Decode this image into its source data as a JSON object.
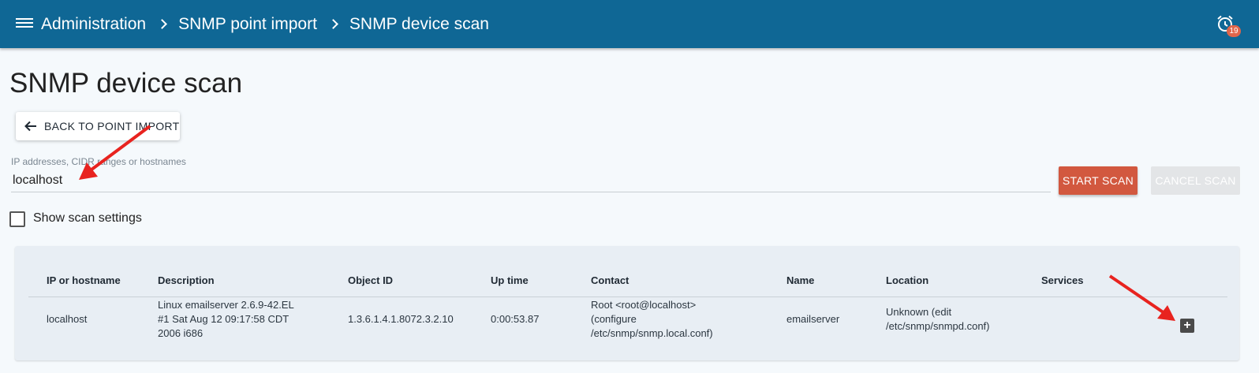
{
  "header": {
    "breadcrumbs": [
      {
        "label": "Administration"
      },
      {
        "label": "SNMP point import"
      },
      {
        "label": "SNMP device scan"
      }
    ],
    "alarm_count": "19"
  },
  "page": {
    "title": "SNMP device scan",
    "back_label": "BACK TO POINT IMPORT"
  },
  "scan": {
    "input_label": "IP addresses, CIDR ranges or hostnames",
    "input_value": "localhost",
    "start_label": "START SCAN",
    "cancel_label": "CANCEL SCAN",
    "show_settings_label": "Show scan settings",
    "show_settings_checked": false
  },
  "table": {
    "columns": [
      "IP or hostname",
      "Description",
      "Object ID",
      "Up time",
      "Contact",
      "Name",
      "Location",
      "Services"
    ],
    "rows": [
      {
        "ip": "localhost",
        "description_lines": [
          "Linux emailserver 2.6.9-42.EL",
          "#1 Sat Aug 12 09:17:58 CDT",
          "2006 i686"
        ],
        "object_id": "1.3.6.1.4.1.8072.3.2.10",
        "uptime": "0:00:53.87",
        "contact_lines": [
          "Root <root@localhost>",
          "(configure",
          "/etc/snmp/snmp.local.conf)"
        ],
        "name": "emailserver",
        "location_lines": [
          "Unknown (edit",
          "/etc/snmp/snmpd.conf)"
        ],
        "services_action": "+"
      }
    ]
  },
  "colors": {
    "topbar": "#0f6795",
    "start_button": "#d2583f",
    "badge": "#e0654a",
    "annotation_arrow": "#e8231f"
  }
}
